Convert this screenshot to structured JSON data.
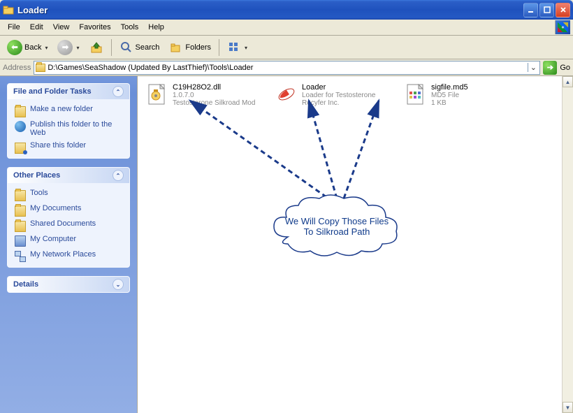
{
  "window": {
    "title": "Loader"
  },
  "menubar": [
    "File",
    "Edit",
    "View",
    "Favorites",
    "Tools",
    "Help"
  ],
  "toolbar": {
    "back": "Back",
    "search": "Search",
    "folders": "Folders"
  },
  "address": {
    "label": "Address",
    "path": "D:\\Games\\SeaShadow (Updated By LastThief)\\Tools\\Loader",
    "go": "Go"
  },
  "sidebar": {
    "tasks": {
      "title": "File and Folder Tasks",
      "items": [
        "Make a new folder",
        "Publish this folder to the Web",
        "Share this folder"
      ]
    },
    "other": {
      "title": "Other Places",
      "items": [
        "Tools",
        "My Documents",
        "Shared Documents",
        "My Computer",
        "My Network Places"
      ]
    },
    "details": {
      "title": "Details"
    }
  },
  "files": [
    {
      "name": "C19H28O2.dll",
      "line1": "1.0.7.0",
      "line2": "Testosterone Silkroad Mod"
    },
    {
      "name": "Loader",
      "line1": "Loader for Testosterone",
      "line2": "Recyfer Inc."
    },
    {
      "name": "sigfile.md5",
      "line1": "MD5 File",
      "line2": "1 KB"
    }
  ],
  "annotation": "We Will Copy Those Files To Silkroad Path"
}
